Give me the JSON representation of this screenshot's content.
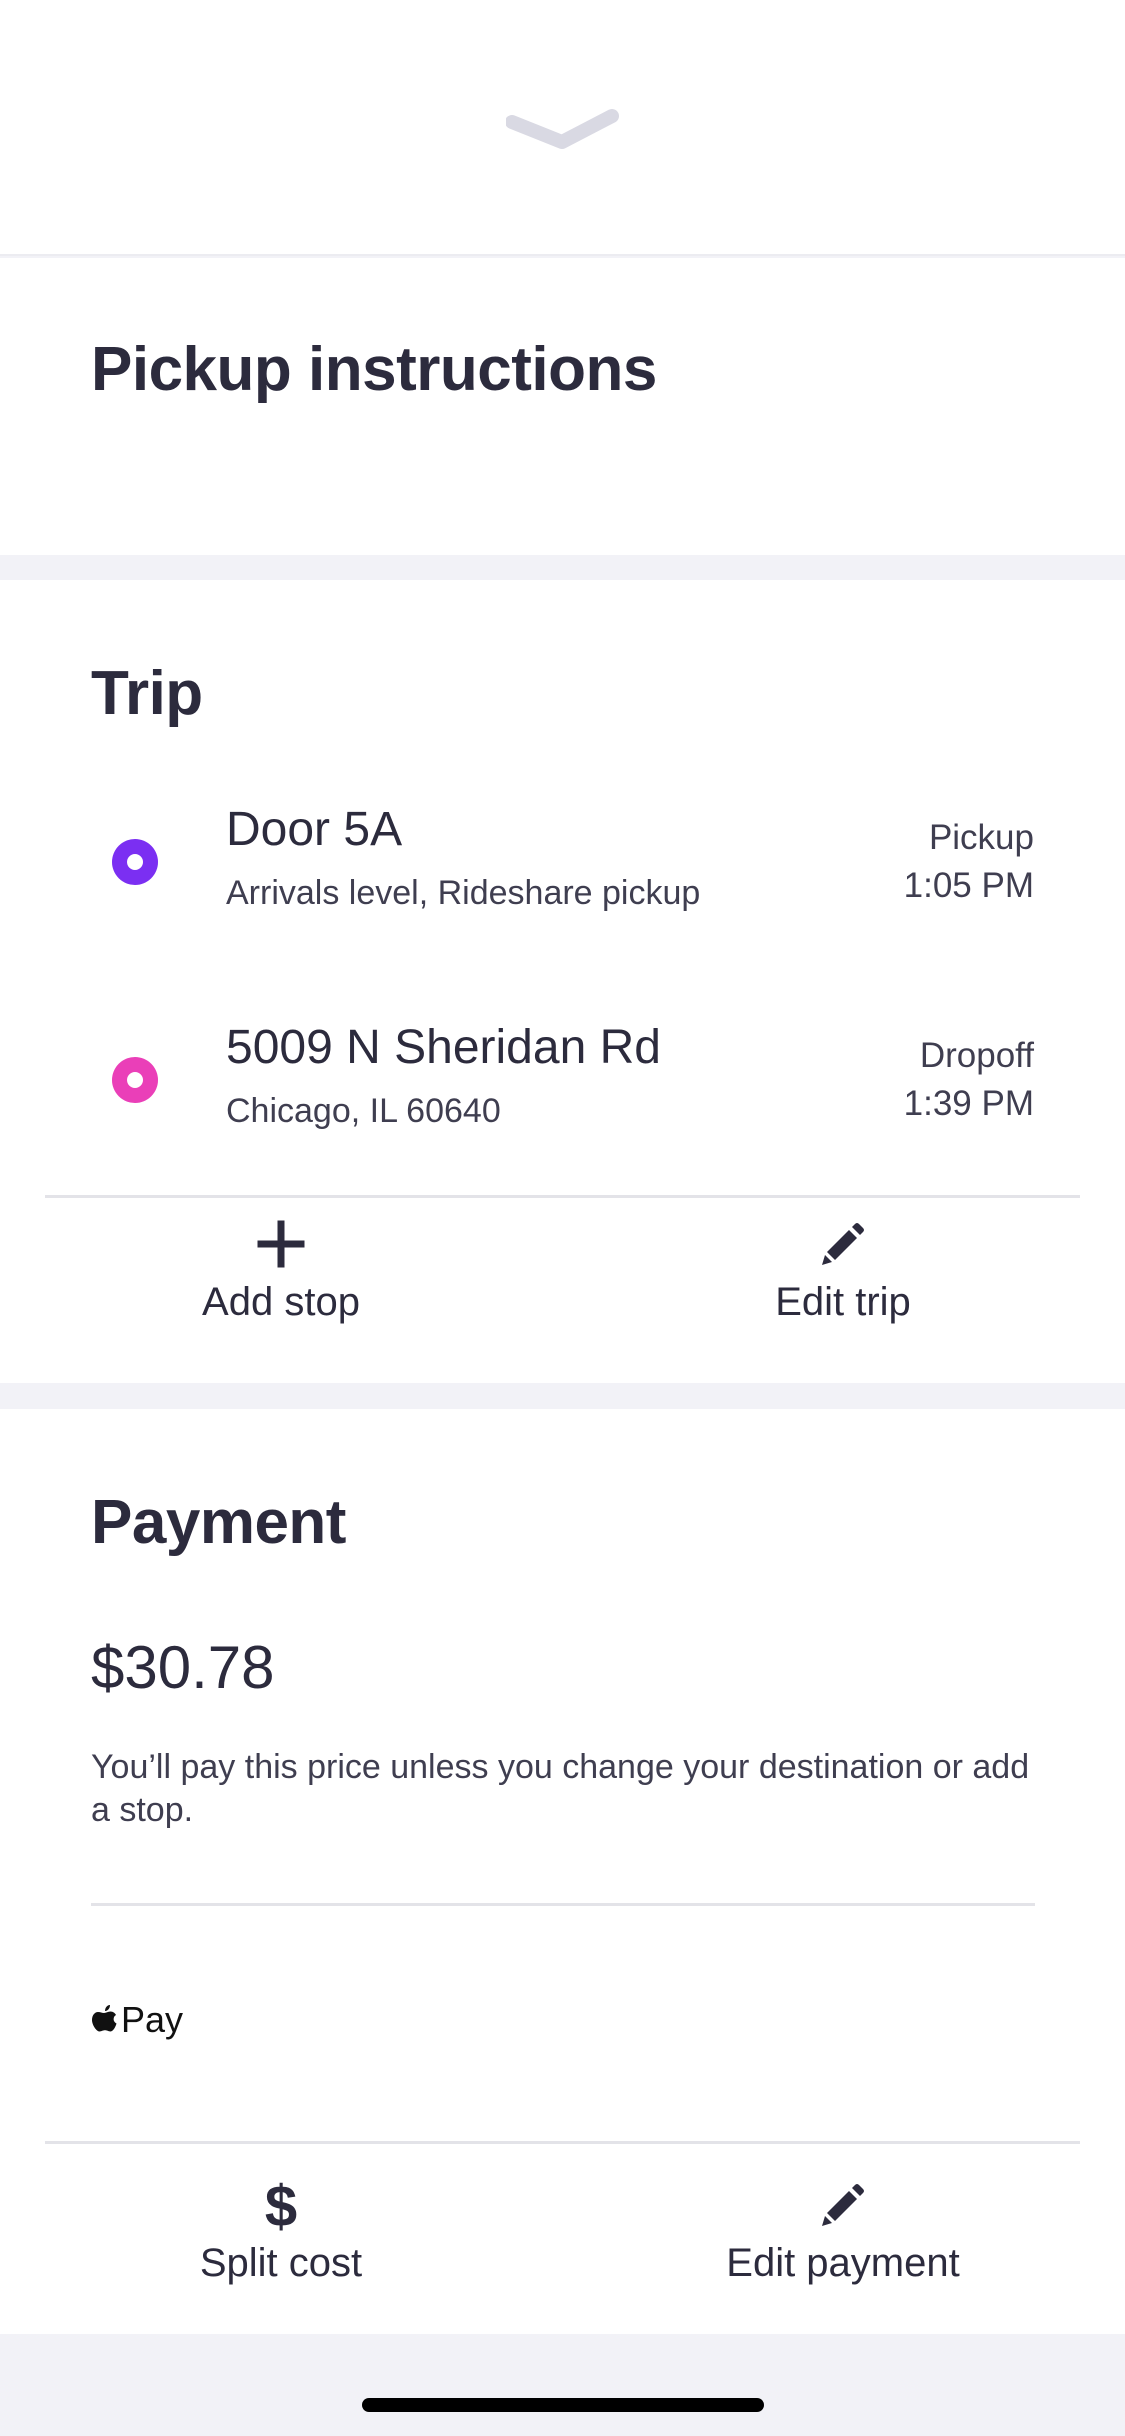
{
  "sheet": {
    "collapse_icon": "chevron-down-icon"
  },
  "pickup_instructions": {
    "title": "Pickup instructions"
  },
  "trip": {
    "title": "Trip",
    "stops": [
      {
        "name": "Door 5A",
        "detail": "Arrivals level, Rideshare pickup",
        "kind": "Pickup",
        "time": "1:05 PM",
        "dot_color": "#7b2ff2"
      },
      {
        "name": "5009 N Sheridan Rd",
        "detail": "Chicago, IL 60640",
        "kind": "Dropoff",
        "time": "1:39 PM",
        "dot_color": "#ea3fb8"
      }
    ],
    "actions": {
      "add_stop": "Add stop",
      "edit_trip": "Edit trip"
    }
  },
  "payment": {
    "title": "Payment",
    "price": "$30.78",
    "note": "You’ll pay this price unless you change your destination or add a stop.",
    "method": "Pay",
    "actions": {
      "split_cost": "Split cost",
      "edit_payment": "Edit payment"
    }
  }
}
